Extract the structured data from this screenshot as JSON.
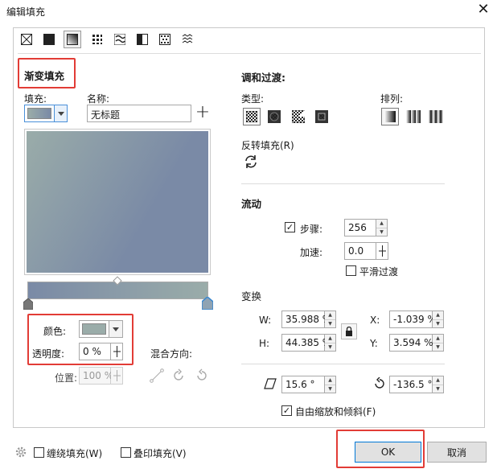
{
  "window": {
    "title": "编辑填充",
    "close_glyph": "✕"
  },
  "fill_types": [
    "no-fill",
    "uniform-fill",
    "fountain-fill",
    "vector-pattern-fill",
    "bitmap-pattern-fill",
    "two-color-pattern-fill",
    "texture-fill",
    "postscript-fill"
  ],
  "gradient": {
    "section_title": "渐变填充",
    "fill_label": "填充:",
    "name_label": "名称:",
    "name_value": "无标题",
    "add_glyph": "+",
    "start_color": "#9aaca9",
    "end_color": "#7a8aa6"
  },
  "node": {
    "color_label": "颜色:",
    "color_swatch": "#9aaca9",
    "transparency_label": "透明度:",
    "transparency_value": "0 %",
    "position_label": "位置:",
    "position_value": "100 %",
    "blend_label": "混合方向:"
  },
  "blend": {
    "section_title": "调和过渡:",
    "type_label": "类型:",
    "arrange_label": "排列:",
    "reverse_label": "反转填充(R)"
  },
  "flow": {
    "section_title": "流动",
    "steps_label": "步骤:",
    "steps_value": "256",
    "steps_checked": true,
    "accel_label": "加速:",
    "accel_value": "0.0",
    "smooth_label": "平滑过渡",
    "smooth_checked": false
  },
  "transform": {
    "section_title": "变换",
    "w_label": "W:",
    "w_value": "35.988 %",
    "h_label": "H:",
    "h_value": "44.385 %",
    "x_label": "X:",
    "x_value": "-1.039 %",
    "y_label": "Y:",
    "y_value": "3.594 %",
    "skew_value": "15.6 °",
    "rotate_value": "-136.5 °",
    "free_scale_label": "自由缩放和倾斜(F)",
    "free_scale_checked": true
  },
  "footer": {
    "wrap_label": "缠绕填充(W)",
    "overprint_label": "叠印填充(V)",
    "ok_label": "OK",
    "cancel_label": "取消"
  }
}
